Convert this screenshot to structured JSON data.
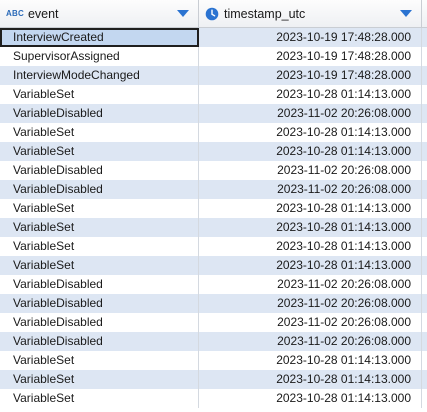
{
  "columns": [
    {
      "type_badge": "ABC",
      "label": "event"
    },
    {
      "label": "timestamp_utc"
    }
  ],
  "icons": {
    "col1_type": "text-type-icon",
    "col2_type": "clock-icon",
    "sort": "chevron-down-icon"
  },
  "colors": {
    "accent": "#2a73d1",
    "row_alt": "#dde6f3",
    "selection": "#c3d7f0"
  },
  "rows": [
    {
      "event": "InterviewCreated",
      "timestamp_utc": "2023-10-19 17:48:28.000"
    },
    {
      "event": "SupervisorAssigned",
      "timestamp_utc": "2023-10-19 17:48:28.000"
    },
    {
      "event": "InterviewModeChanged",
      "timestamp_utc": "2023-10-19 17:48:28.000"
    },
    {
      "event": "VariableSet",
      "timestamp_utc": "2023-10-28 01:14:13.000"
    },
    {
      "event": "VariableDisabled",
      "timestamp_utc": "2023-11-02 20:26:08.000"
    },
    {
      "event": "VariableSet",
      "timestamp_utc": "2023-10-28 01:14:13.000"
    },
    {
      "event": "VariableSet",
      "timestamp_utc": "2023-10-28 01:14:13.000"
    },
    {
      "event": "VariableDisabled",
      "timestamp_utc": "2023-11-02 20:26:08.000"
    },
    {
      "event": "VariableDisabled",
      "timestamp_utc": "2023-11-02 20:26:08.000"
    },
    {
      "event": "VariableSet",
      "timestamp_utc": "2023-10-28 01:14:13.000"
    },
    {
      "event": "VariableSet",
      "timestamp_utc": "2023-10-28 01:14:13.000"
    },
    {
      "event": "VariableSet",
      "timestamp_utc": "2023-10-28 01:14:13.000"
    },
    {
      "event": "VariableSet",
      "timestamp_utc": "2023-10-28 01:14:13.000"
    },
    {
      "event": "VariableDisabled",
      "timestamp_utc": "2023-11-02 20:26:08.000"
    },
    {
      "event": "VariableDisabled",
      "timestamp_utc": "2023-11-02 20:26:08.000"
    },
    {
      "event": "VariableDisabled",
      "timestamp_utc": "2023-11-02 20:26:08.000"
    },
    {
      "event": "VariableDisabled",
      "timestamp_utc": "2023-11-02 20:26:08.000"
    },
    {
      "event": "VariableSet",
      "timestamp_utc": "2023-10-28 01:14:13.000"
    },
    {
      "event": "VariableSet",
      "timestamp_utc": "2023-10-28 01:14:13.000"
    },
    {
      "event": "VariableSet",
      "timestamp_utc": "2023-10-28 01:14:13.000"
    }
  ]
}
